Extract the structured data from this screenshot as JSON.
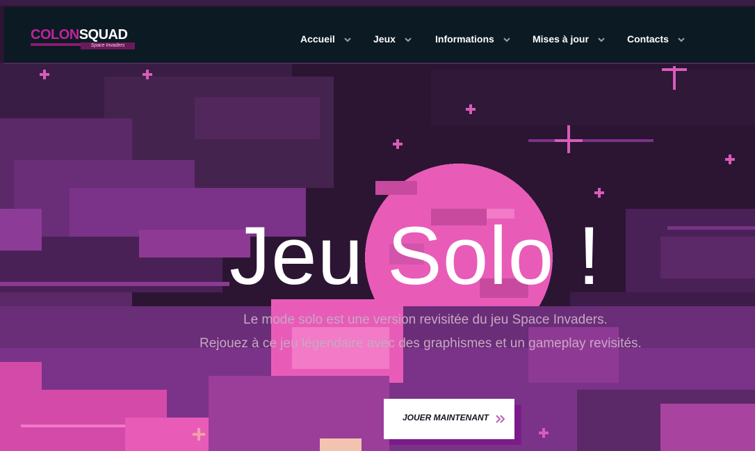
{
  "logo": {
    "part1": "COLON",
    "part2": "SQUAD",
    "tagline": "Space Invaders"
  },
  "nav": {
    "items": [
      {
        "label": "Accueil"
      },
      {
        "label": "Jeux"
      },
      {
        "label": "Informations"
      },
      {
        "label": "Mises à jour"
      },
      {
        "label": "Contacts"
      }
    ]
  },
  "hero": {
    "title": "Jeu Solo !",
    "line1": "Le mode solo est une version revisitée du jeu Space Invaders.",
    "line2": "Rejouez à ce jeu légendaire avec des graphismes et un gameplay revisités.",
    "cta_label": "JOUER MAINTENANT"
  },
  "icons": {
    "nav_dropdown": "chevron-down-icon",
    "cta_arrow": "double-chevron-right-icon"
  },
  "colors": {
    "navbar_bg": "#0c1a24",
    "brand_magenta": "#c0249a",
    "planet_pink": "#e85cb8",
    "sky_dark": "#2b1533",
    "cloud_purple": "#6a2d78",
    "cloud_pink": "#d44aa8",
    "cta_shadow": "#7c1a8b"
  }
}
